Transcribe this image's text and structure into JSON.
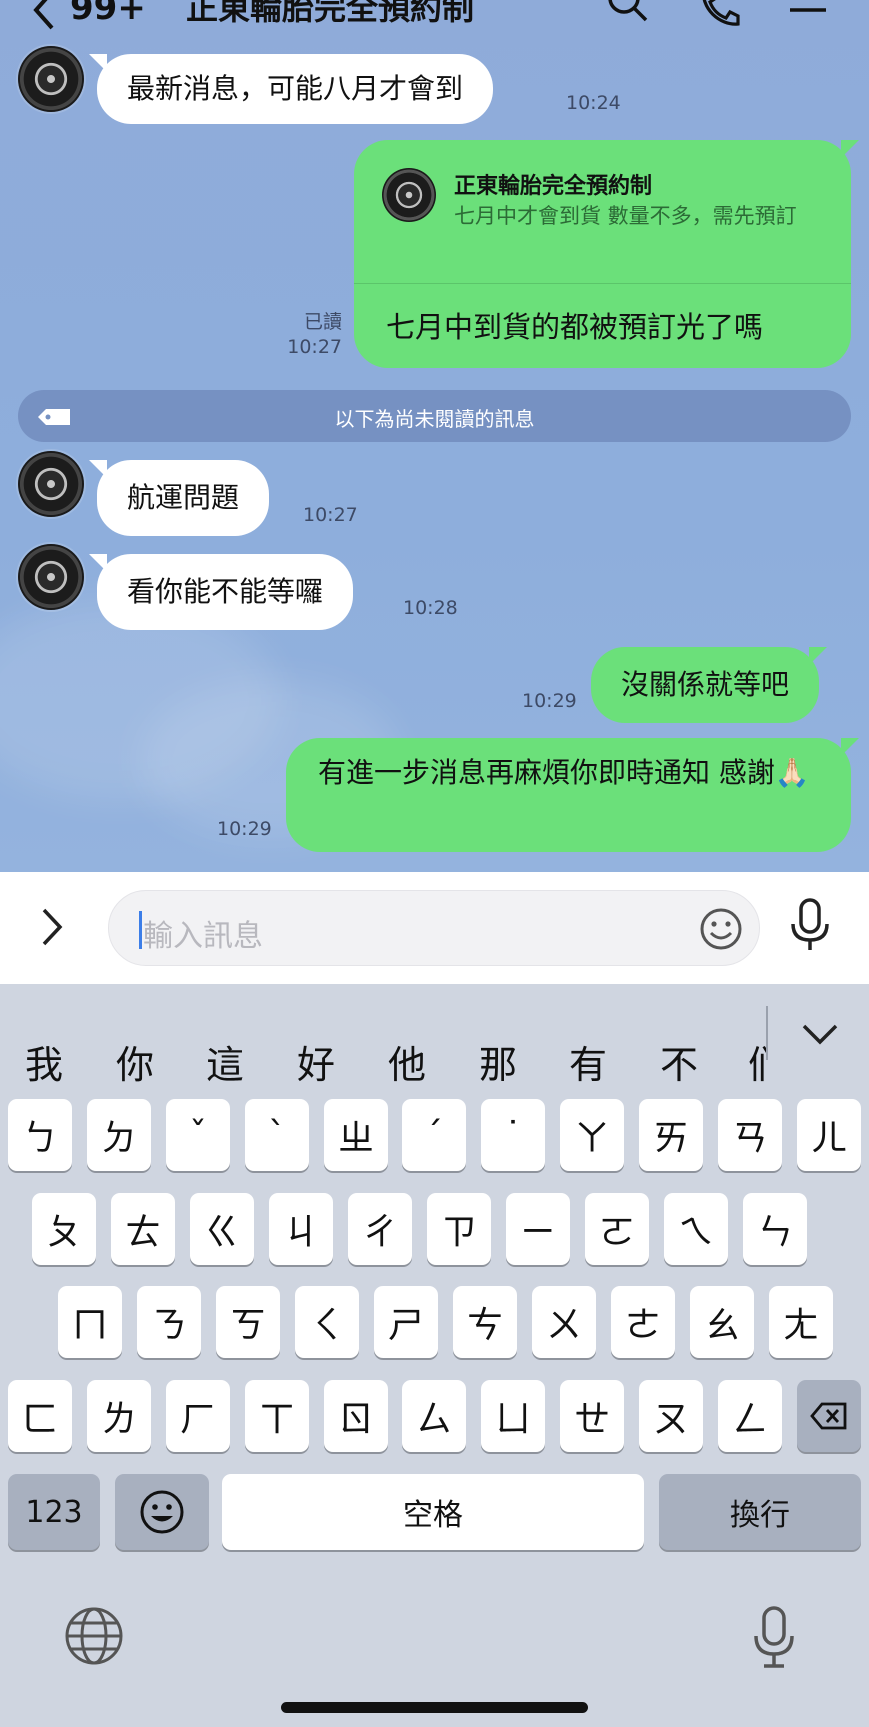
{
  "header": {
    "back_icon": "chevron-left-icon",
    "unread_count": "99+",
    "title": "正東輪胎完全預約制",
    "icons": [
      "search-icon",
      "phone-icon",
      "menu-icon"
    ]
  },
  "messages": {
    "m1": {
      "text": "最新消息，可能八月才會到",
      "time": "10:24"
    },
    "reply": {
      "quoted_name": "正東輪胎完全預約制",
      "quoted_text": "七月中才會到貨 數量不多，需先預訂",
      "text": "七月中到貨的都被預訂光了嗎",
      "read": "已讀",
      "time": "10:27"
    },
    "unread_divider": "以下為尚未閱讀的訊息",
    "m2": {
      "text": "航運問題",
      "time": "10:27"
    },
    "m3": {
      "text": "看你能不能等囉",
      "time": "10:28"
    },
    "m4": {
      "text": "沒關係就等吧",
      "time": "10:29"
    },
    "m5": {
      "text": "有進一步消息再麻煩你即時通知 感謝🙏🏻",
      "time": "10:29"
    }
  },
  "input": {
    "placeholder": "輸入訊息"
  },
  "keyboard": {
    "candidates": [
      "我",
      "你",
      "這",
      "好",
      "他",
      "那",
      "有",
      "不",
      "们"
    ],
    "row1": [
      "ㄅ",
      "ㄉ",
      "ˇ",
      "ˋ",
      "ㄓ",
      "ˊ",
      "˙",
      "ㄚ",
      "ㄞ",
      "ㄢ",
      "ㄦ"
    ],
    "row2": [
      "ㄆ",
      "ㄊ",
      "ㄍ",
      "ㄐ",
      "ㄔ",
      "ㄗ",
      "ㄧ",
      "ㄛ",
      "ㄟ",
      "ㄣ"
    ],
    "row3": [
      "ㄇ",
      "ㄋ",
      "ㄎ",
      "ㄑ",
      "ㄕ",
      "ㄘ",
      "ㄨ",
      "ㄜ",
      "ㄠ",
      "ㄤ"
    ],
    "row4": [
      "ㄈ",
      "ㄌ",
      "ㄏ",
      "ㄒ",
      "ㄖ",
      "ㄙ",
      "ㄩ",
      "ㄝ",
      "ㄡ",
      "ㄥ"
    ],
    "numbers": "123",
    "space": "空格",
    "return": "換行"
  }
}
